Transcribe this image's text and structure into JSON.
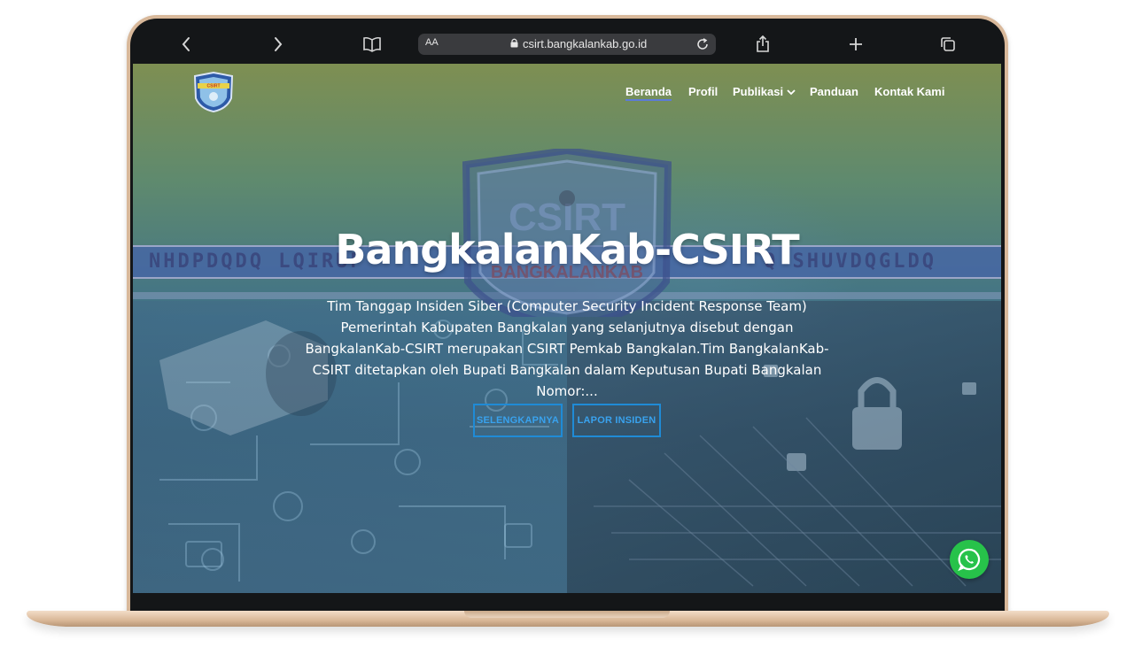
{
  "browser": {
    "url": "csirt.bangkalankab.go.id",
    "text_size_label": "AA",
    "icons": [
      "back-icon",
      "forward-icon",
      "book-icon",
      "lock-icon",
      "reload-icon",
      "share-icon",
      "plus-icon",
      "tabs-icon"
    ]
  },
  "site": {
    "logo_alt": "CSIRT logo",
    "nav": {
      "items": [
        {
          "label": "Beranda",
          "active": true
        },
        {
          "label": "Profil"
        },
        {
          "label": "Publikasi",
          "dropdown": true
        },
        {
          "label": "Panduan"
        },
        {
          "label": "Kontak Kami"
        }
      ]
    },
    "hero": {
      "title": "BangkalanKab-CSIRT",
      "description": "Tim Tanggap Insiden Siber (Computer Security Incident Response Team) Pemerintah Kabupaten Bangkalan yang selanjutnya disebut dengan BangkalanKab-CSIRT merupakan CSIRT Pemkab Bangkalan.Tim BangkalanKab-CSIRT ditetapkan oleh Bupati Bangkalan dalam Keputusan Bupati Bangkalan Nomor:...",
      "buttons": {
        "more": "SELENGKAPNYA",
        "report": "LAPOR INSIDEN"
      },
      "bg_banner": {
        "left_text": "NHDPDQDQ LQIRUP",
        "right_text": "Q SHUVDQGLDQ",
        "shield_text": "BANGKALANKAB"
      }
    },
    "whatsapp_icon": "whatsapp-icon",
    "colors": {
      "accent": "#1f8bd6",
      "whatsapp": "#27c24a",
      "nav_underline": "#5b7bd8"
    }
  }
}
